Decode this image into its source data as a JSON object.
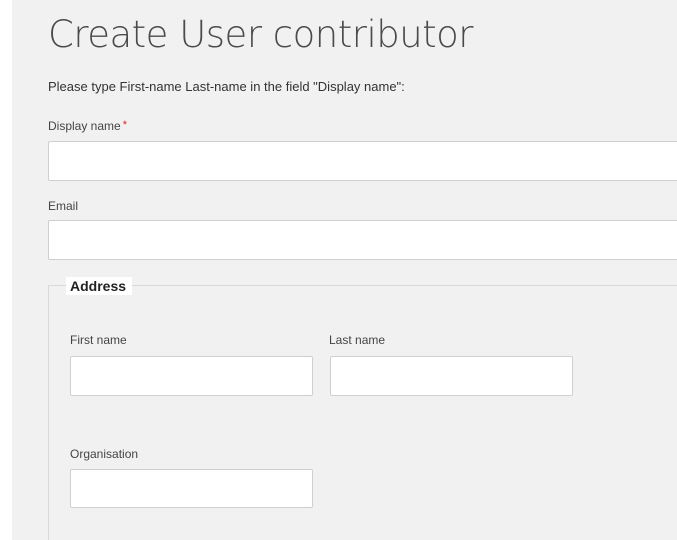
{
  "form": {
    "title": "Create User contributor",
    "instructions": "Please type First-name Last-name in the field \"Display name\":",
    "display_name": {
      "label": "Display name",
      "required_mark": "*",
      "value": ""
    },
    "email": {
      "label": "Email",
      "value": ""
    },
    "address": {
      "legend": "Address",
      "first_name": {
        "label": "First name",
        "value": ""
      },
      "last_name": {
        "label": "Last name",
        "value": ""
      },
      "organisation": {
        "label": "Organisation",
        "value": ""
      }
    }
  },
  "colors": {
    "panel_background": "#f1f1f1",
    "required_mark": "#e02020",
    "input_border": "#cfcfcf"
  }
}
